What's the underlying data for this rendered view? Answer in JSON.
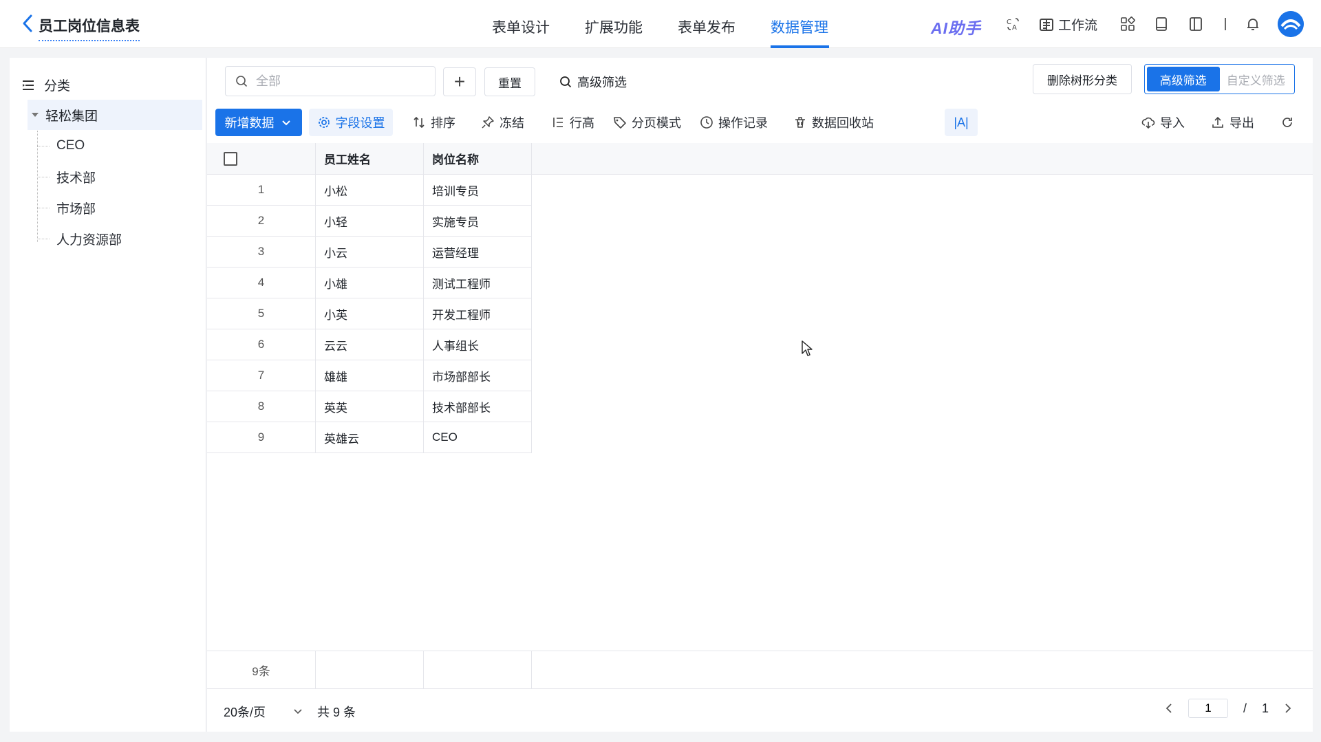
{
  "header": {
    "title": "员工岗位信息表",
    "tabs": [
      {
        "label": "表单设计",
        "active": false
      },
      {
        "label": "扩展功能",
        "active": false
      },
      {
        "label": "表单发布",
        "active": false
      },
      {
        "label": "数据管理",
        "active": true
      }
    ],
    "ai_label": "AI助手",
    "workflow_label": "工作流",
    "accent_color": "#1a73e8"
  },
  "sidebar": {
    "title": "分类",
    "root": "轻松集团",
    "items": [
      {
        "label": "CEO"
      },
      {
        "label": "技术部"
      },
      {
        "label": "市场部"
      },
      {
        "label": "人力资源部"
      }
    ]
  },
  "filter": {
    "search_placeholder": "全部",
    "reset_label": "重置",
    "advanced_filter_link": "高级筛选",
    "delete_tree_label": "删除树形分类",
    "seg_advanced": "高级筛选",
    "seg_custom": "自定义筛选"
  },
  "toolbar": {
    "new_data": "新增数据",
    "field_settings": "字段设置",
    "sort": "排序",
    "freeze": "冻结",
    "row_height": "行高",
    "page_mode": "分页模式",
    "operation_log": "操作记录",
    "recycle_bin": "数据回收站",
    "font_toggle": "|A|",
    "import": "导入",
    "export": "导出"
  },
  "table": {
    "columns": [
      "员工姓名",
      "岗位名称"
    ],
    "rows": [
      {
        "index": "1",
        "name": "小松",
        "position": "培训专员"
      },
      {
        "index": "2",
        "name": "小轻",
        "position": "实施专员"
      },
      {
        "index": "3",
        "name": "小云",
        "position": "运营经理"
      },
      {
        "index": "4",
        "name": "小雄",
        "position": "测试工程师"
      },
      {
        "index": "5",
        "name": "小英",
        "position": "开发工程师"
      },
      {
        "index": "6",
        "name": "云云",
        "position": "人事组长"
      },
      {
        "index": "7",
        "name": "雄雄",
        "position": "市场部部长"
      },
      {
        "index": "8",
        "name": "英英",
        "position": "技术部部长"
      },
      {
        "index": "9",
        "name": "英雄云",
        "position": "CEO"
      }
    ],
    "summary_count": "9条"
  },
  "pager": {
    "page_size": "20条/页",
    "total": "共 9 条",
    "current_page": "1",
    "separator": "/",
    "total_pages": "1"
  }
}
